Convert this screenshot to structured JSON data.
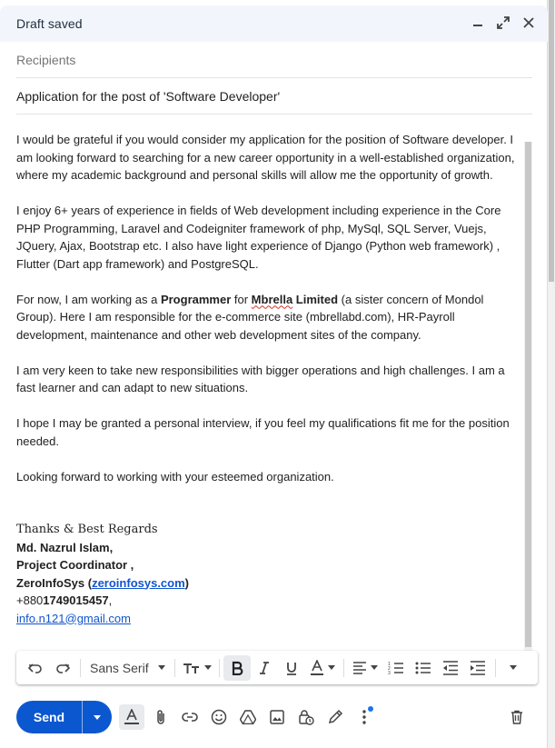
{
  "window": {
    "title": "Draft saved"
  },
  "recipients": {
    "placeholder": "Recipients"
  },
  "subject": {
    "value": "Application for the post of 'Software Developer'"
  },
  "body": {
    "p1": "I would be grateful if you would consider my application for the position of Software developer. I am looking forward to searching for a new career opportunity in a well-established organization, where my academic background and personal skills will allow me the opportunity of growth.",
    "p2": "I enjoy 6+ years of experience in fields of Web development including experience in the Core PHP Programming, Laravel and Codeigniter framework of php, MySql, SQL Server, Vuejs, JQuery, Ajax, Bootstrap etc. I also have light experience of Django (Python web framework) , Flutter (Dart app framework) and PostgreSQL.",
    "p3_a": "For now, I am working as a ",
    "p3_role": "Programmer",
    "p3_b": " for ",
    "p3_company_1": "Mbrella",
    "p3_company_2": " Limited",
    "p3_c": " (a sister concern of Mondol Group). Here I am responsible for the e-commerce site (mbrellabd.com), HR-Payroll development, maintenance and other web development sites of the company.",
    "p4": "I am very keen to take new responsibilities with bigger operations and high challenges. I am a fast learner and can adapt to new situations.",
    "p5": "I hope I may be granted a personal interview, if you feel my qualifications fit me for the position needed.",
    "p6": "Looking forward to working with your esteemed organization."
  },
  "signature": {
    "closing": "Thanks & Best Regards",
    "name": "Md. Nazrul Islam,",
    "title": "Project Coordinator ,",
    "company": "ZeroInfoSys",
    "company_open": " (",
    "company_link": "zeroinfosys.com",
    "company_close": ")",
    "phone_prefix": "+880",
    "phone_number": "1749015457",
    "phone_suffix": ",",
    "email": "info.n121@gmail.com"
  },
  "format_toolbar": {
    "font": "Sans Serif",
    "icons": [
      "undo-icon",
      "redo-icon",
      "text-size-icon",
      "bold-icon",
      "italic-icon",
      "underline-icon",
      "text-color-icon",
      "align-icon",
      "numbered-list-icon",
      "bulleted-list-icon",
      "indent-less-icon",
      "indent-more-icon",
      "more-formatting-icon"
    ]
  },
  "bottom_toolbar": {
    "send_label": "Send",
    "icons": [
      "formatting-options-icon",
      "attach-icon",
      "link-icon",
      "emoji-icon",
      "drive-icon",
      "photo-icon",
      "confidential-icon",
      "signature-icon",
      "more-options-icon",
      "discard-icon"
    ]
  },
  "colors": {
    "accent": "#0b57d0",
    "title_bar": "#f2f6fc",
    "link": "#1155cc",
    "notification_dot": "#1a73e8"
  }
}
